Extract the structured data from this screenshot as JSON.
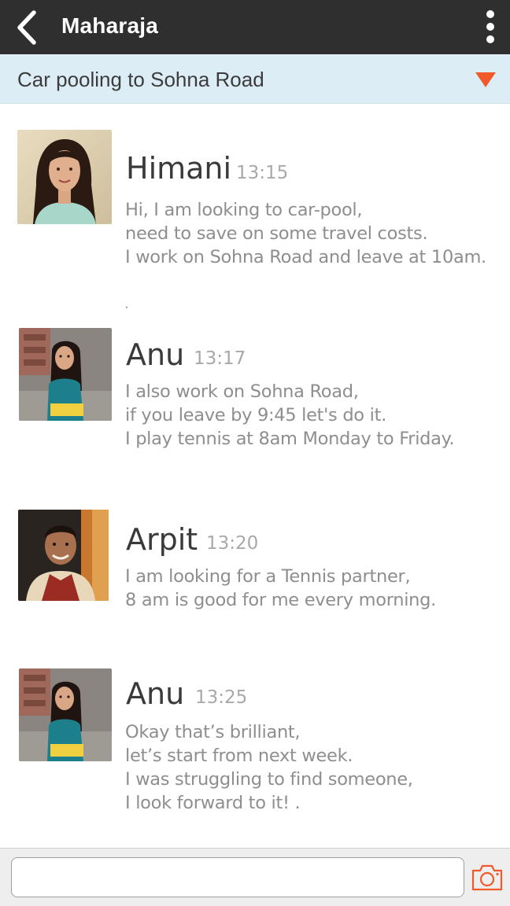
{
  "app_bar": {
    "title": "Maharaja",
    "back_icon": "chevron-left-icon",
    "menu_icon": "more-vertical-icon",
    "background": "#2f2f2f"
  },
  "topic": {
    "title": "Car pooling to Sohna Road",
    "dropdown_icon": "triangle-down-icon",
    "background": "#dcedf6",
    "accent": "#f05a2b"
  },
  "messages": [
    {
      "name": "Himani",
      "time": "13:15",
      "lines": [
        "Hi, I am looking to car-pool,",
        "need to save on some travel costs.",
        "I work on Sohna Road and leave at 10am."
      ],
      "trailing": "."
    },
    {
      "name": "Anu",
      "time": "13:17",
      "lines": [
        "I also work on Sohna Road,",
        "if you leave by 9:45 let's do it.",
        "I play tennis at 8am Monday to Friday."
      ]
    },
    {
      "name": "Arpit",
      "time": "13:20",
      "lines": [
        "I am looking for a Tennis partner,",
        "8 am is good for me every morning."
      ]
    },
    {
      "name": "Anu",
      "time": "13:25",
      "lines": [
        "Okay that’s brilliant,",
        "let’s start from next week.",
        "I was struggling to find someone,",
        "I look forward to it!  ."
      ]
    }
  ],
  "composer": {
    "value": "",
    "placeholder": "",
    "camera_icon": "camera-icon"
  }
}
